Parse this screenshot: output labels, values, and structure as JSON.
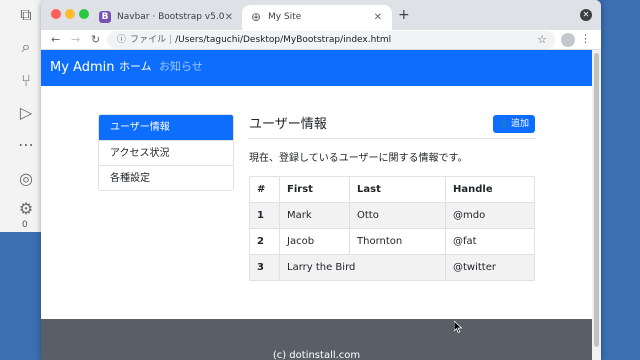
{
  "colors": {
    "primary": "#0d6efd",
    "footer": "#585f66",
    "desktop": "#3b6fb1"
  },
  "editor": {
    "activity_icons": [
      "files-icon",
      "search-icon",
      "source-control-icon",
      "run-debug-icon",
      "more-icon",
      "account-icon",
      "settings-icon"
    ],
    "status_text": "0"
  },
  "browser": {
    "tabs": [
      {
        "title": "Navbar · Bootstrap v5.0",
        "icon": "bootstrap-icon"
      },
      {
        "title": "My Site",
        "icon": "globe-icon"
      }
    ],
    "address": {
      "scheme": "ファイル",
      "path": "/Users/taguchi/Desktop/MyBootstrap/index.html"
    }
  },
  "page": {
    "navbar": {
      "brand": "My Admin",
      "links": [
        "ホーム",
        "お知らせ"
      ]
    },
    "sidebar": {
      "items": [
        "ユーザー情報",
        "アクセス状況",
        "各種設定"
      ]
    },
    "main": {
      "title": "ユーザー情報",
      "add_button": "追加",
      "description": "現在、登録しているユーザーに関する情報です。",
      "table": {
        "headers": [
          "#",
          "First",
          "Last",
          "Handle"
        ],
        "rows": [
          [
            "1",
            "Mark",
            "Otto",
            "@mdo"
          ],
          [
            "2",
            "Jacob",
            "Thornton",
            "@fat"
          ],
          [
            "3",
            "Larry the Bird",
            "",
            "@twitter"
          ]
        ]
      }
    },
    "footer": {
      "text": "(c) dotinstall.com"
    }
  }
}
